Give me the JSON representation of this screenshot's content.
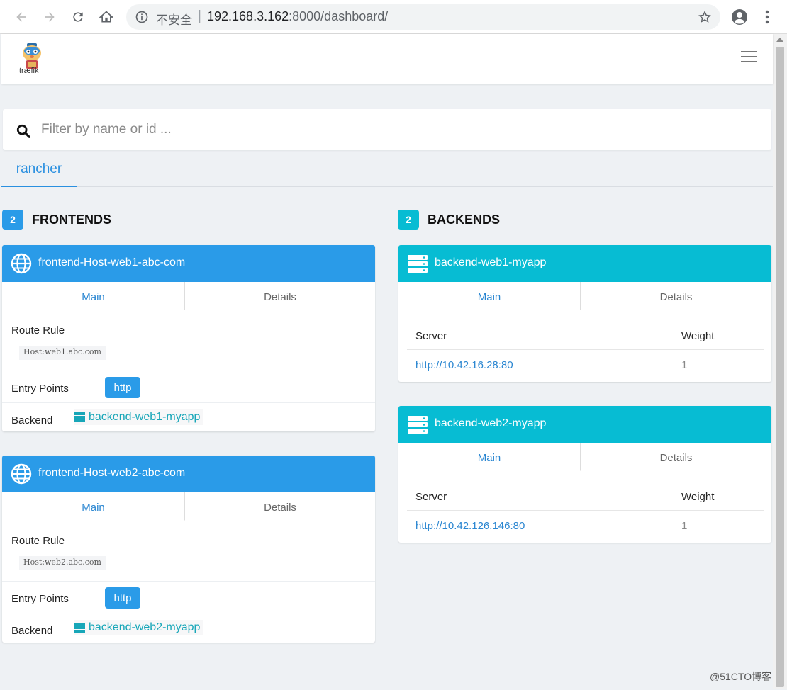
{
  "browser": {
    "insecure_label": "不安全",
    "separator": "|",
    "url_host": "192.168.3.162",
    "url_rest": ":8000/dashboard/"
  },
  "app": {
    "logo_text": "træfik"
  },
  "search": {
    "placeholder": "Filter by name or id ..."
  },
  "provider_tabs": [
    {
      "label": "rancher"
    }
  ],
  "frontends_section": {
    "count": "2",
    "label": "FRONTENDS"
  },
  "backends_section": {
    "count": "2",
    "label": "BACKENDS"
  },
  "frontends": [
    {
      "name": "frontend-Host-web1-abc-com",
      "tab_main": "Main",
      "tab_details": "Details",
      "route_rule_label": "Route Rule",
      "route_rule": "Host:web1.abc.com",
      "entry_points_label": "Entry Points",
      "entry_point": "http",
      "backend_label": "Backend",
      "backend": "backend-web1-myapp"
    },
    {
      "name": "frontend-Host-web2-abc-com",
      "tab_main": "Main",
      "tab_details": "Details",
      "route_rule_label": "Route Rule",
      "route_rule": "Host:web2.abc.com",
      "entry_points_label": "Entry Points",
      "entry_point": "http",
      "backend_label": "Backend",
      "backend": "backend-web2-myapp"
    }
  ],
  "backends": [
    {
      "name": "backend-web1-myapp",
      "tab_main": "Main",
      "tab_details": "Details",
      "server_header": "Server",
      "weight_header": "Weight",
      "server_url": "http://10.42.16.28:80",
      "weight": "1"
    },
    {
      "name": "backend-web2-myapp",
      "tab_main": "Main",
      "tab_details": "Details",
      "server_header": "Server",
      "weight_header": "Weight",
      "server_url": "http://10.42.126.146:80",
      "weight": "1"
    }
  ],
  "watermark": "@51CTO博客",
  "colors": {
    "frontend_accent": "#2a9be8",
    "backend_accent": "#07bcd3",
    "link": "#2a86d1",
    "backend_link": "#17a6b8"
  },
  "icons": {
    "frontend": "globe-icon",
    "backend": "server-icon",
    "search": "search-icon"
  }
}
